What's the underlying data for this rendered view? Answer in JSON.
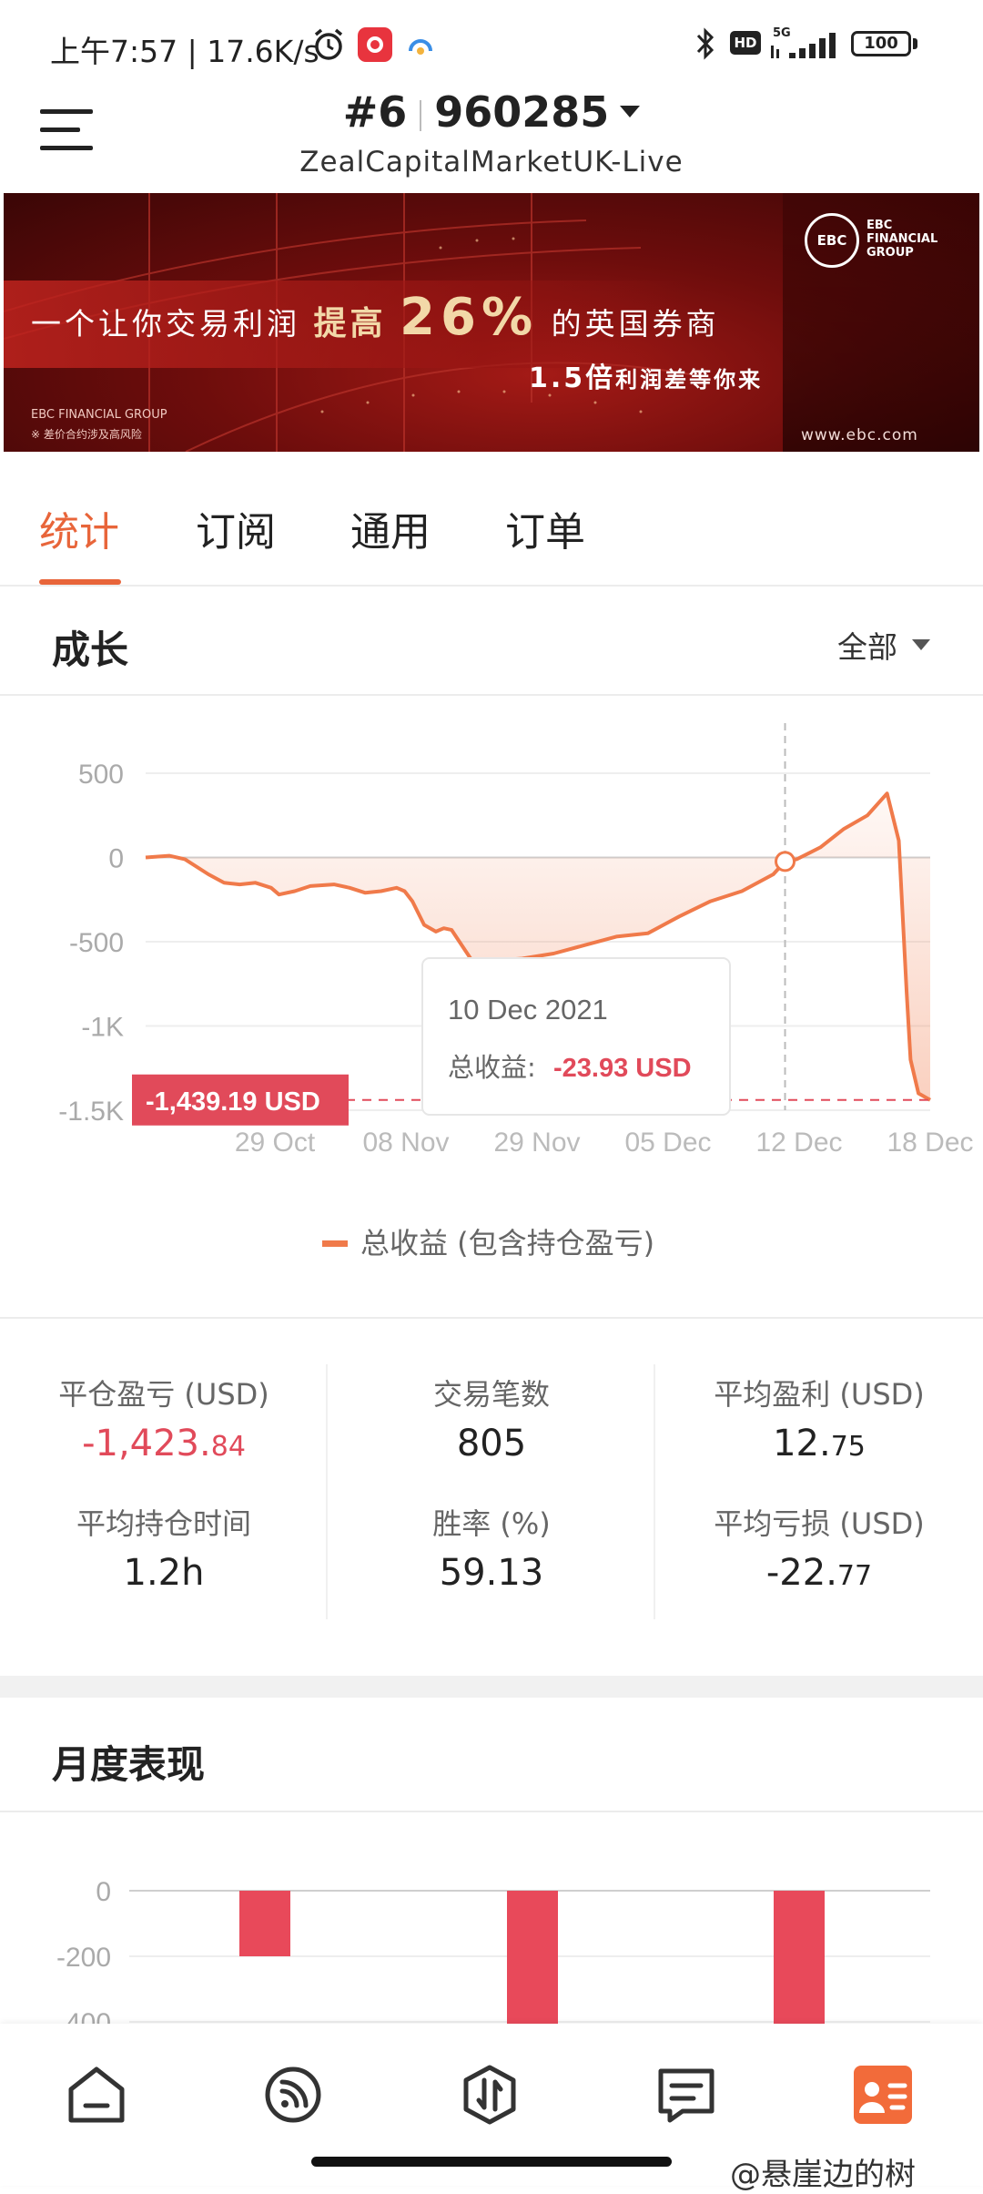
{
  "status_bar": {
    "time_speed": "上午7:57 | 17.6K/s",
    "hd": "HD",
    "network": "5G",
    "battery": "100"
  },
  "header": {
    "account_prefix": "#6",
    "account_number": "960285",
    "server": "ZealCapitalMarketUK-Live"
  },
  "banner": {
    "line1_a": "一个让你交易利润",
    "line1_b": "提高",
    "line1_c": "26%",
    "line1_d": "的英国券商",
    "line2_a": "1.5倍",
    "line2_b": "利润差等你来",
    "brand_small": "EBC FINANCIAL GROUP",
    "disclaimer": "※ 差价合约涉及高风险",
    "url": "www.ebc.com",
    "logo_text": "EBC",
    "logo_lines": [
      "EBC",
      "FINANCIAL",
      "GROUP"
    ]
  },
  "tabs": [
    "统计",
    "订阅",
    "通用",
    "订单"
  ],
  "growth": {
    "title": "成长",
    "filter": "全部"
  },
  "chart_data": {
    "type": "line",
    "title": "",
    "x_ticks": [
      "29 Oct",
      "08 Nov",
      "29 Nov",
      "05 Dec",
      "12 Dec",
      "18 Dec"
    ],
    "y_ticks": [
      "500",
      "0",
      "-500",
      "-1K",
      "-1.5K"
    ],
    "ylim": [
      -1500,
      500
    ],
    "series": [
      {
        "name": "总收益 (包含持仓盈亏)",
        "color": "#f07a4a",
        "x": [
          0.0,
          0.03,
          0.05,
          0.08,
          0.1,
          0.12,
          0.14,
          0.16,
          0.17,
          0.19,
          0.21,
          0.24,
          0.26,
          0.28,
          0.3,
          0.32,
          0.33,
          0.34,
          0.355,
          0.37,
          0.38,
          0.39,
          0.42,
          0.45,
          0.48,
          0.52,
          0.56,
          0.6,
          0.64,
          0.68,
          0.72,
          0.76,
          0.8,
          0.815,
          0.83,
          0.86,
          0.89,
          0.92,
          0.945,
          0.96,
          0.97,
          0.975,
          0.985,
          1.0
        ],
        "values": [
          0,
          10,
          -10,
          -100,
          -150,
          -160,
          -150,
          -180,
          -220,
          -200,
          -170,
          -160,
          -180,
          -210,
          -200,
          -180,
          -200,
          -260,
          -400,
          -440,
          -420,
          -430,
          -640,
          -610,
          -600,
          -570,
          -520,
          -470,
          -450,
          -350,
          -260,
          -200,
          -100,
          -23.93,
          -10,
          60,
          170,
          250,
          380,
          100,
          -800,
          -1200,
          -1400,
          -1439.19
        ]
      }
    ],
    "grid": true,
    "legend": "bottom",
    "current_value_label": "-1,439.19 USD",
    "tooltip": {
      "date": "10 Dec 2021",
      "label": "总收益:",
      "value": "-23.93 USD"
    }
  },
  "stats": [
    {
      "label": "平仓盈亏 (USD)",
      "int": "-1,423.",
      "dec": "84",
      "negative": true
    },
    {
      "label": "交易笔数",
      "int": "805",
      "dec": ""
    },
    {
      "label": "平均盈利 (USD)",
      "int": "12.",
      "dec": "75"
    },
    {
      "label": "平均持仓时间",
      "int": "1.2h",
      "dec": ""
    },
    {
      "label": "胜率 (%)",
      "int": "59.13",
      "dec": ""
    },
    {
      "label": "平均亏损 (USD)",
      "int": "-22.",
      "dec": "77"
    }
  ],
  "monthly": {
    "title": "月度表现",
    "chart_data": {
      "type": "bar",
      "y_ticks": [
        "0",
        "-200",
        "-400"
      ],
      "values": [
        -200,
        -430,
        -430
      ],
      "color": "#e8495a"
    }
  },
  "bottom_nav": [
    "home-icon",
    "feed-icon",
    "trade-icon",
    "messages-icon",
    "profile-icon"
  ],
  "watermark": "@悬崖边的树"
}
